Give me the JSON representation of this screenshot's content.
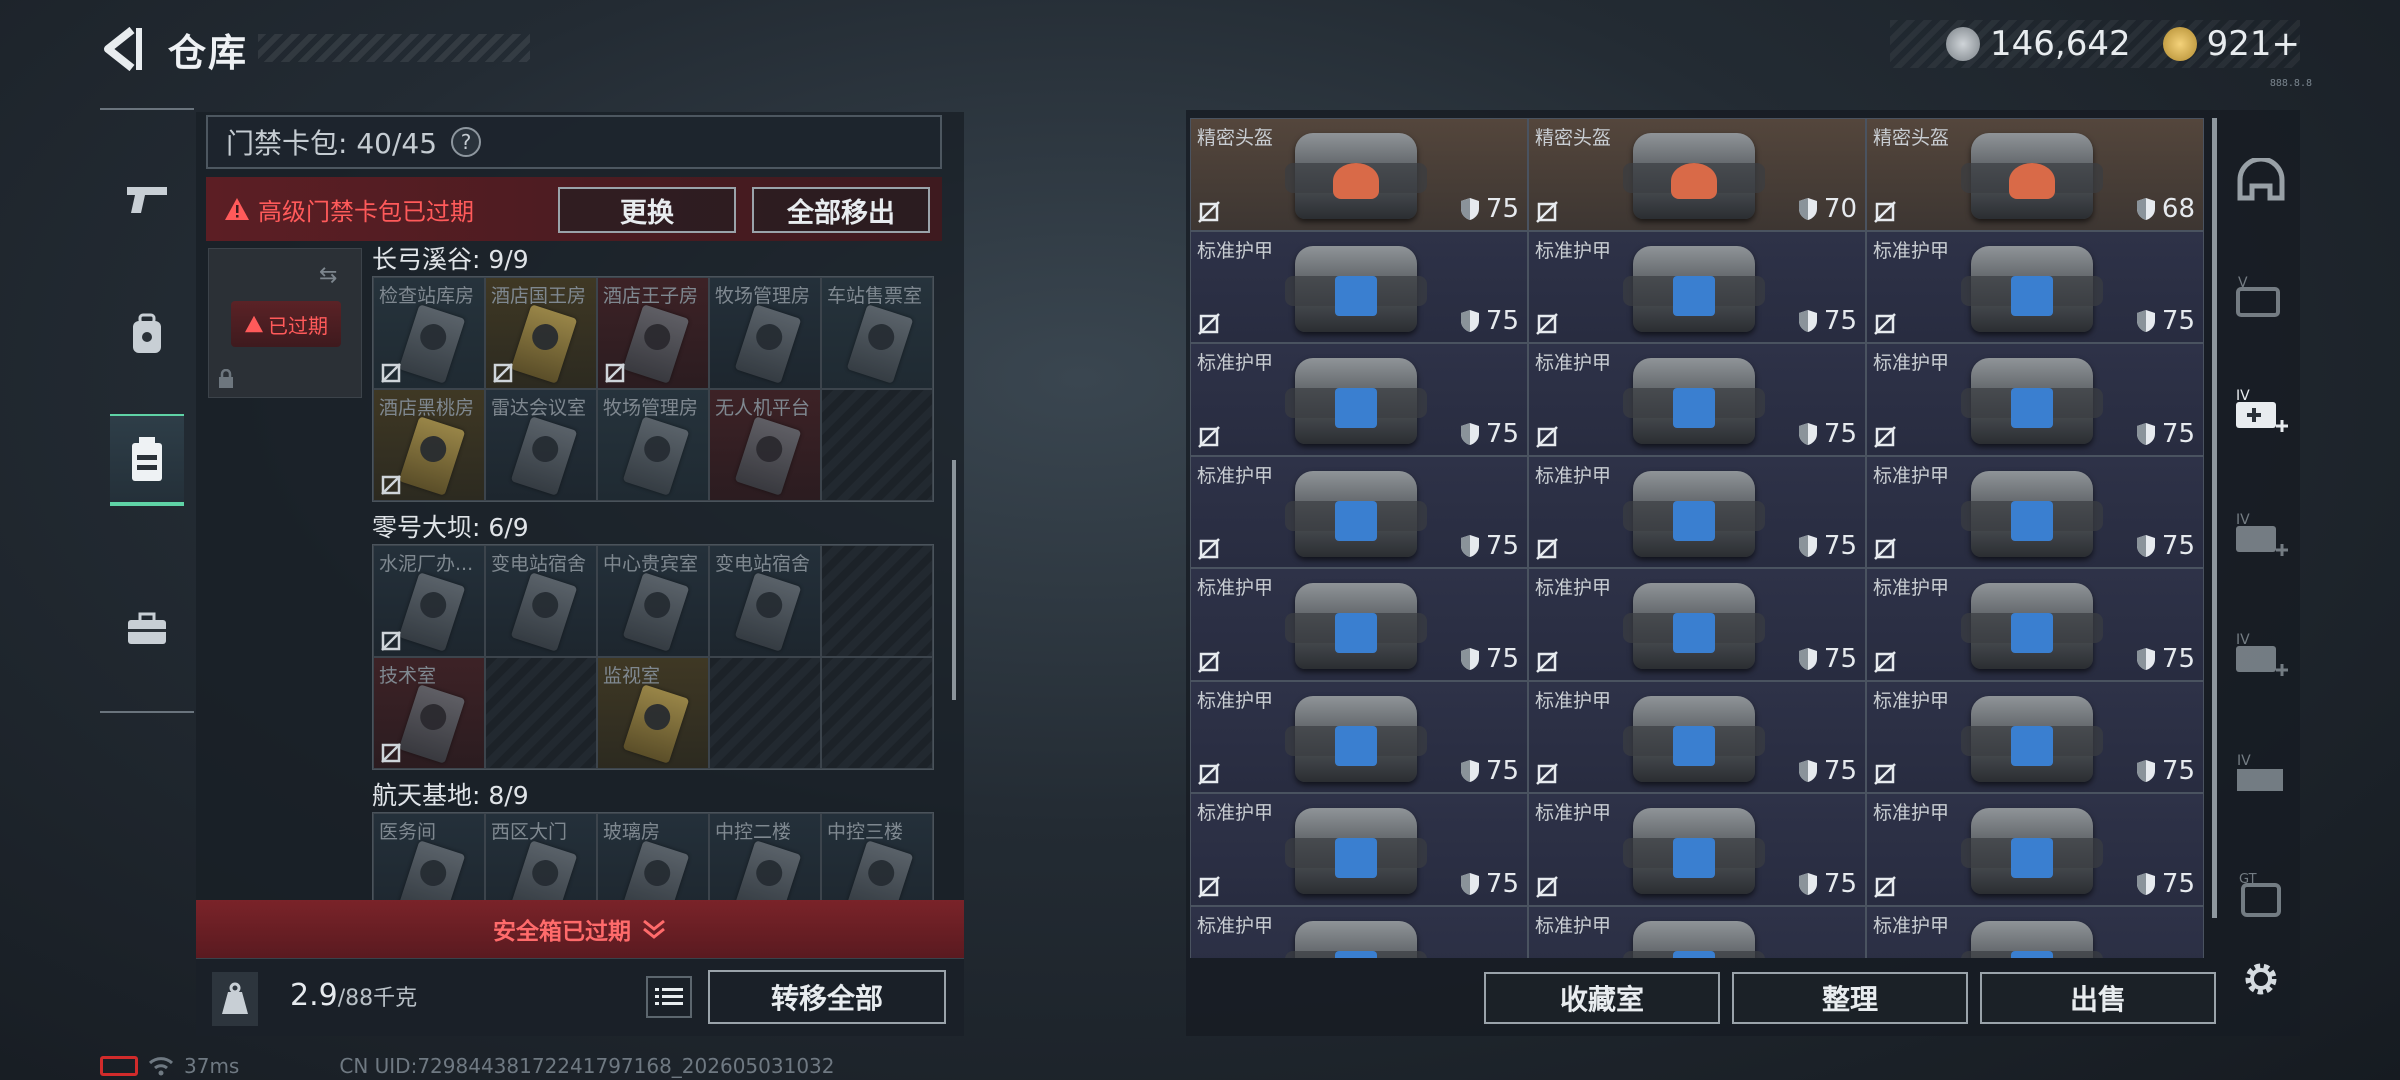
{
  "header": {
    "title": "仓库",
    "currency_1": "146,642",
    "currency_2": "921+",
    "version_tag": "888.8.8"
  },
  "keycard": {
    "label": "门禁卡包: 40/45",
    "help": "?",
    "expired_notice": "高级门禁卡包已过期",
    "replace_btn": "更换",
    "move_all_btn": "全部移出",
    "slot_expired": "已过期"
  },
  "groups": [
    {
      "title": "长弓溪谷: 9/9",
      "cells": [
        {
          "name": "检查站库房",
          "tone": "c-blue",
          "card": true,
          "nodur": true
        },
        {
          "name": "酒店国王房",
          "tone": "c-gold",
          "card": true,
          "nodur": true
        },
        {
          "name": "酒店王子房",
          "tone": "c-red",
          "card": true,
          "nodur": true
        },
        {
          "name": "牧场管理房",
          "tone": "c-dark",
          "card": true,
          "nodur": false
        },
        {
          "name": "车站售票室",
          "tone": "c-blue",
          "card": true,
          "nodur": false
        },
        {
          "name": "酒店黑桃房",
          "tone": "c-gold",
          "card": true,
          "nodur": true
        },
        {
          "name": "雷达会议室",
          "tone": "c-dark",
          "card": true,
          "nodur": false
        },
        {
          "name": "牧场管理房",
          "tone": "c-blue",
          "card": true,
          "nodur": false
        },
        {
          "name": "无人机平台",
          "tone": "c-red",
          "card": true,
          "nodur": false
        },
        {
          "name": "",
          "tone": "",
          "card": false,
          "nodur": false
        }
      ]
    },
    {
      "title": "零号大坝: 6/9",
      "cells": [
        {
          "name": "水泥厂办...",
          "tone": "c-dark",
          "card": true,
          "nodur": true
        },
        {
          "name": "变电站宿舍",
          "tone": "c-dark",
          "card": true,
          "nodur": false
        },
        {
          "name": "中心贵宾室",
          "tone": "c-dark",
          "card": true,
          "nodur": false
        },
        {
          "name": "变电站宿舍",
          "tone": "c-dark",
          "card": true,
          "nodur": false
        },
        {
          "name": "",
          "tone": "",
          "card": false,
          "nodur": false
        },
        {
          "name": "技术室",
          "tone": "c-red",
          "card": true,
          "nodur": true
        },
        {
          "name": "",
          "tone": "",
          "card": false,
          "nodur": false
        },
        {
          "name": "监视室",
          "tone": "c-gold",
          "card": true,
          "nodur": false
        },
        {
          "name": "",
          "tone": "",
          "card": false,
          "nodur": false
        },
        {
          "name": "",
          "tone": "",
          "card": false,
          "nodur": false
        }
      ]
    },
    {
      "title": "航天基地: 8/9",
      "cells": [
        {
          "name": "医务间",
          "tone": "c-dark",
          "card": true,
          "nodur": false
        },
        {
          "name": "西区大门",
          "tone": "c-dark",
          "card": true,
          "nodur": false
        },
        {
          "name": "玻璃房",
          "tone": "c-dark",
          "card": true,
          "nodur": false
        },
        {
          "name": "中控二楼",
          "tone": "c-dark",
          "card": true,
          "nodur": false
        },
        {
          "name": "中控三楼",
          "tone": "c-dark",
          "card": true,
          "nodur": false
        }
      ]
    }
  ],
  "safebox": {
    "label": "安全箱已过期"
  },
  "footer": {
    "weight_value": "2.9",
    "weight_max": "/88千克",
    "transfer_btn": "转移全部"
  },
  "status": {
    "ping": "37ms",
    "uid": "CN UID:7298443817224179716​8_202605031032"
  },
  "items": [
    {
      "name": "精密头盔",
      "val": "75",
      "kind": "helm"
    },
    {
      "name": "精密头盔",
      "val": "70",
      "kind": "helm"
    },
    {
      "name": "精密头盔",
      "val": "68",
      "kind": "helm"
    },
    {
      "name": "标准护甲",
      "val": "75",
      "kind": "armor"
    },
    {
      "name": "标准护甲",
      "val": "75",
      "kind": "armor"
    },
    {
      "name": "标准护甲",
      "val": "75",
      "kind": "armor"
    },
    {
      "name": "标准护甲",
      "val": "75",
      "kind": "armor"
    },
    {
      "name": "标准护甲",
      "val": "75",
      "kind": "armor"
    },
    {
      "name": "标准护甲",
      "val": "75",
      "kind": "armor"
    },
    {
      "name": "标准护甲",
      "val": "75",
      "kind": "armor"
    },
    {
      "name": "标准护甲",
      "val": "75",
      "kind": "armor"
    },
    {
      "name": "标准护甲",
      "val": "75",
      "kind": "armor"
    },
    {
      "name": "标准护甲",
      "val": "75",
      "kind": "armor"
    },
    {
      "name": "标准护甲",
      "val": "75",
      "kind": "armor"
    },
    {
      "name": "标准护甲",
      "val": "75",
      "kind": "armor"
    },
    {
      "name": "标准护甲",
      "val": "75",
      "kind": "armor"
    },
    {
      "name": "标准护甲",
      "val": "75",
      "kind": "armor"
    },
    {
      "name": "标准护甲",
      "val": "75",
      "kind": "armor"
    },
    {
      "name": "标准护甲",
      "val": "75",
      "kind": "armor"
    },
    {
      "name": "标准护甲",
      "val": "75",
      "kind": "armor"
    },
    {
      "name": "标准护甲",
      "val": "75",
      "kind": "armor"
    },
    {
      "name": "标准护甲",
      "val": "",
      "kind": "armor"
    },
    {
      "name": "标准护甲",
      "val": "",
      "kind": "armor"
    },
    {
      "name": "标准护甲",
      "val": "",
      "kind": "armor"
    }
  ],
  "actions": {
    "collection": "收藏室",
    "organize": "整理",
    "sell": "出售"
  },
  "colors": {
    "accent": "#5fd3a6",
    "warning": "#ff5a5a"
  }
}
